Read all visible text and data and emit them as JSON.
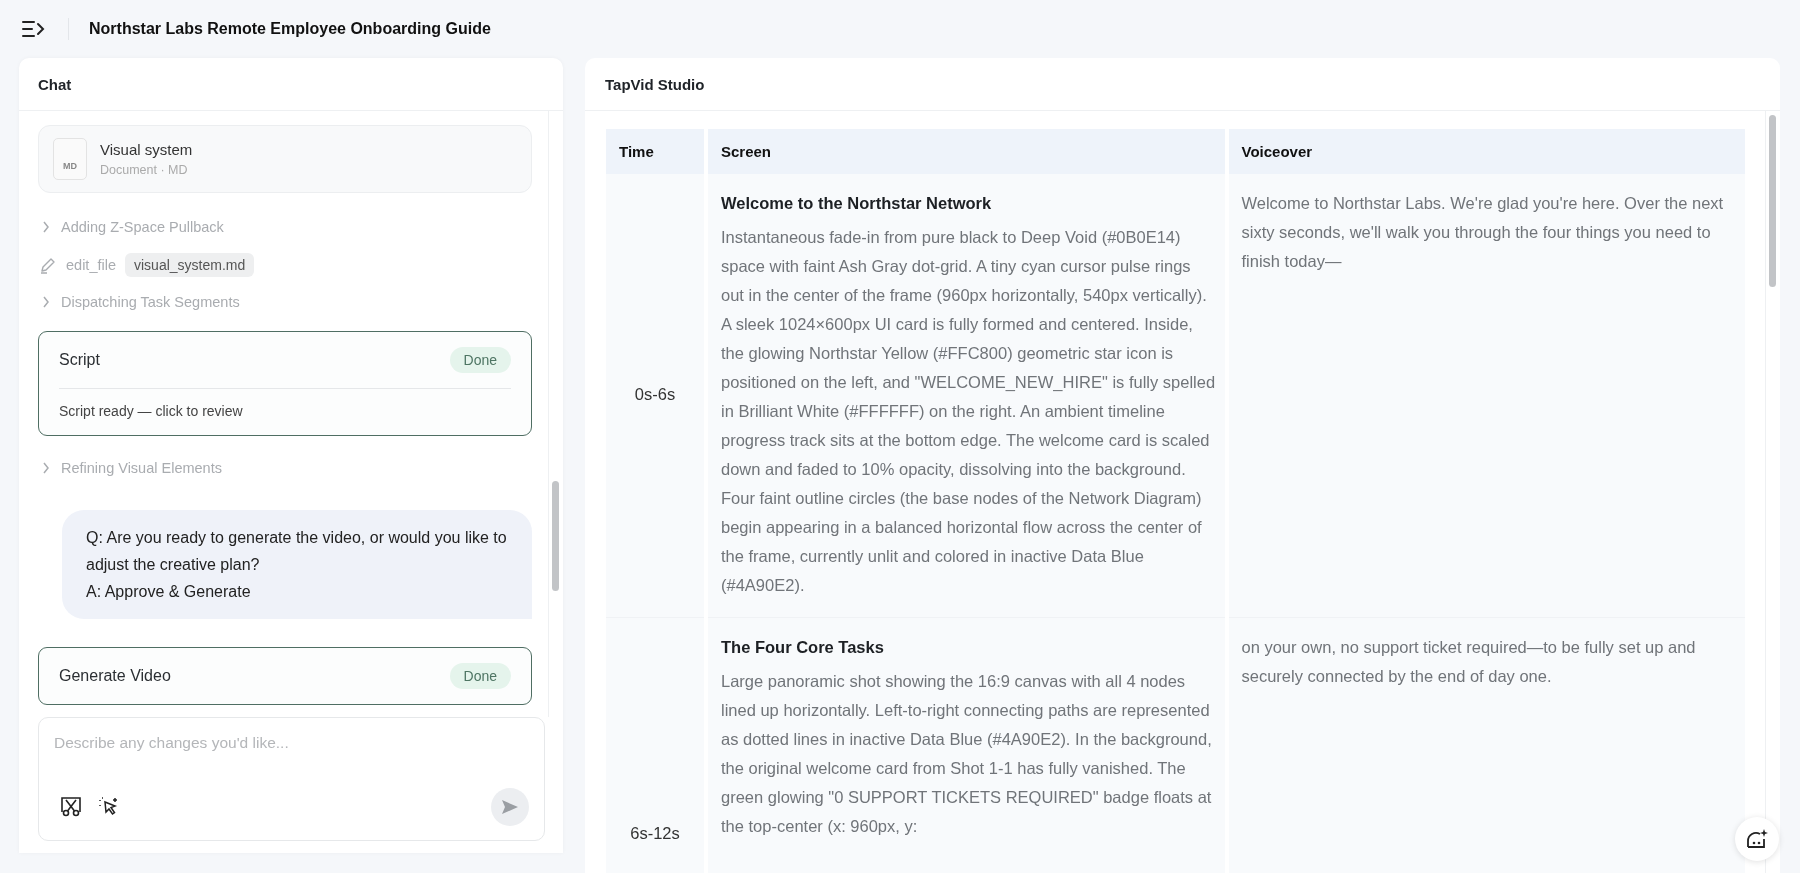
{
  "header": {
    "title": "Northstar Labs Remote Employee Onboarding Guide"
  },
  "chat": {
    "title": "Chat",
    "items": [
      {
        "kind": "file",
        "name": "Visual system",
        "meta": "Document · MD",
        "badge": "MD"
      },
      {
        "kind": "step",
        "label": "Adding Z-Space Pullback",
        "expanded": false
      },
      {
        "kind": "tool",
        "tool": "edit_file",
        "file": "visual_system.md"
      },
      {
        "kind": "step",
        "label": "Dispatching Task Segments",
        "expanded": false
      },
      {
        "kind": "task",
        "title": "Script",
        "status": "Done",
        "note": "Script ready — click to review"
      },
      {
        "kind": "step",
        "label": "Refining Visual Elements",
        "expanded": false
      },
      {
        "kind": "message",
        "question": "Q: Are you ready to generate the video, or would you like to adjust the creative plan?",
        "answer": "A: Approve & Generate"
      },
      {
        "kind": "task",
        "title": "Generate Video",
        "status": "Done"
      }
    ],
    "input": {
      "placeholder": "Describe any changes you'd like..."
    }
  },
  "studio": {
    "title": "TapVid Studio",
    "table": {
      "columns": [
        "Time",
        "Screen",
        "Voiceover"
      ],
      "rows": [
        {
          "time": "0s-6s",
          "screen_title": "Welcome to the Northstar Network",
          "screen_text": "Instantaneous fade-in from pure black to Deep Void (#0B0E14) space with faint Ash Gray dot-grid. A tiny cyan cursor pulse rings out in the center of the frame (960px horizontally, 540px vertically). A sleek 1024×600px UI card is fully formed and centered. Inside, the glowing Northstar Yellow (#FFC800) geometric star icon is positioned on the left, and \"WELCOME_NEW_HIRE\" is fully spelled in Brilliant White (#FFFFFF) on the right. An ambient timeline progress track sits at the bottom edge. The welcome card is scaled down and faded to 10% opacity, dissolving into the background. Four faint outline circles (the base nodes of the Network Diagram) begin appearing in a balanced horizontal flow across the center of the frame, currently unlit and colored in inactive Data Blue (#4A90E2).",
          "voiceover": "Welcome to Northstar Labs. We're glad you're here. Over the next sixty seconds, we'll walk you through the four things you need to finish today—"
        },
        {
          "time": "6s-12s",
          "screen_title": "The Four Core Tasks",
          "screen_text": "Large panoramic shot showing the 16:9 canvas with all 4 nodes lined up horizontally. Left-to-right connecting paths are represented as dotted lines in inactive Data Blue (#4A90E2). In the background, the original welcome card from Shot 1-1 has fully vanished. The green glowing \"0 SUPPORT TICKETS REQUIRED\" badge floats at the top-center (x: 960px, y:",
          "voiceover": "on your own, no support ticket required—to be fully set up and securely connected by the end of day one."
        }
      ]
    }
  }
}
